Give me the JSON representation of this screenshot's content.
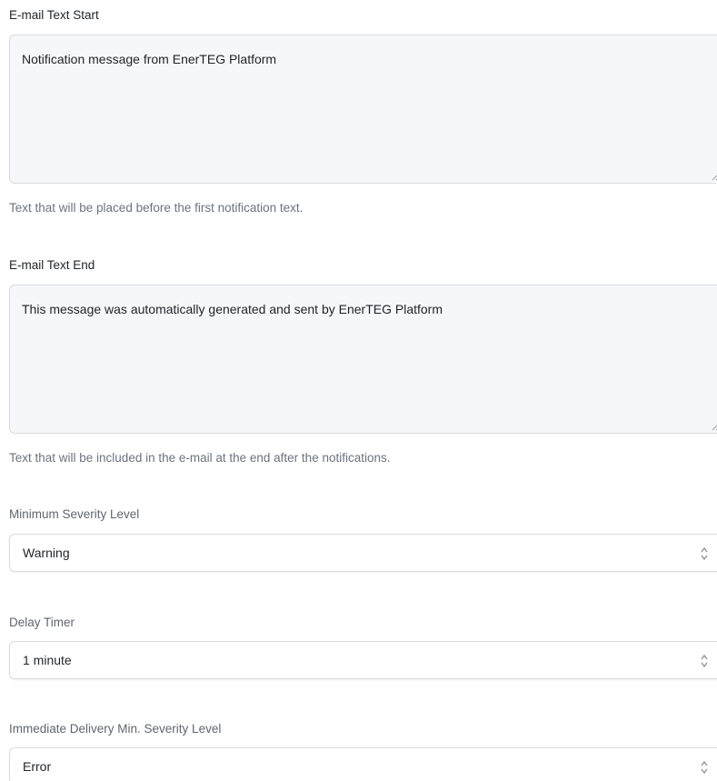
{
  "email_text_start": {
    "label": "E-mail Text Start",
    "value": "Notification message from EnerTEG Platform",
    "help": "Text that will be placed before the first notification text."
  },
  "email_text_end": {
    "label": "E-mail Text End",
    "value": "This message was automatically generated and sent by EnerTEG Platform",
    "help": "Text that will be included in the e-mail at the end after the notifications."
  },
  "minimum_severity": {
    "label": "Minimum Severity Level",
    "selected": "Warning"
  },
  "delay_timer": {
    "label": "Delay Timer",
    "selected": "1 minute"
  },
  "immediate_delivery": {
    "label": "Immediate Delivery Min. Severity Level",
    "selected": "Error"
  },
  "icons": {
    "select_indicator": "chevron-up-down-icon",
    "textarea_resize": "resize-grip-icon"
  }
}
